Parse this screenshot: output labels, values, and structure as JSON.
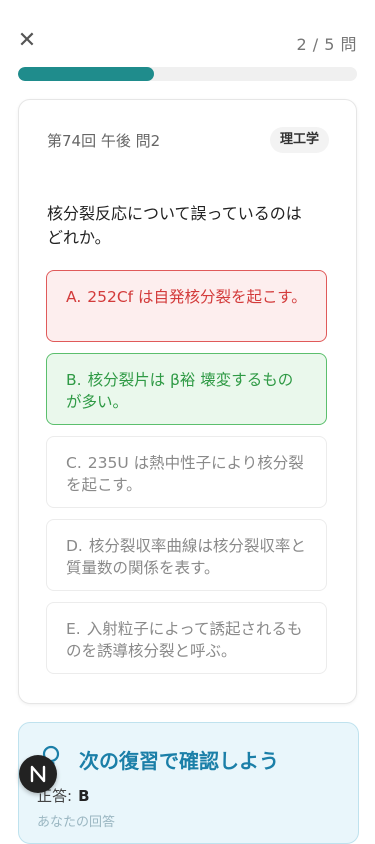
{
  "header": {
    "close_icon": "close-icon",
    "counter": "2 / 5 問",
    "progress": 0.4
  },
  "card": {
    "meta": "第74回 午後 問2",
    "subject": "理工学",
    "question": "核分裂反応について誤っているのはどれか。",
    "options": [
      {
        "letter": "A.",
        "text": "252Cf は自発核分裂を起こす。",
        "state": "wrong"
      },
      {
        "letter": "B.",
        "text": "核分裂片は β裕 壊変するものが多い。",
        "state": "correct"
      },
      {
        "letter": "C.",
        "text": "235U は熱中性子により核分裂を起こす。",
        "state": "neutral"
      },
      {
        "letter": "D.",
        "text": "核分裂収率曲線は核分裂収率と質量数の関係を表す。",
        "state": "neutral"
      },
      {
        "letter": "E.",
        "text": "入射粒子によって誘起されるものを誘導核分裂と呼ぶ。",
        "state": "neutral"
      }
    ]
  },
  "review": {
    "icon": "lightbulb-icon",
    "title": "次の復習で確認しよう",
    "answer_label": "正答:",
    "answer_value": "B",
    "faint_text": "あなたの回答"
  },
  "fab": {
    "label": "N",
    "icon": "app-logo-icon"
  },
  "colors": {
    "accent": "#1f8c8c",
    "wrong": "#d33b3b",
    "correct": "#2f9a45",
    "review_title": "#1b7fa8"
  }
}
